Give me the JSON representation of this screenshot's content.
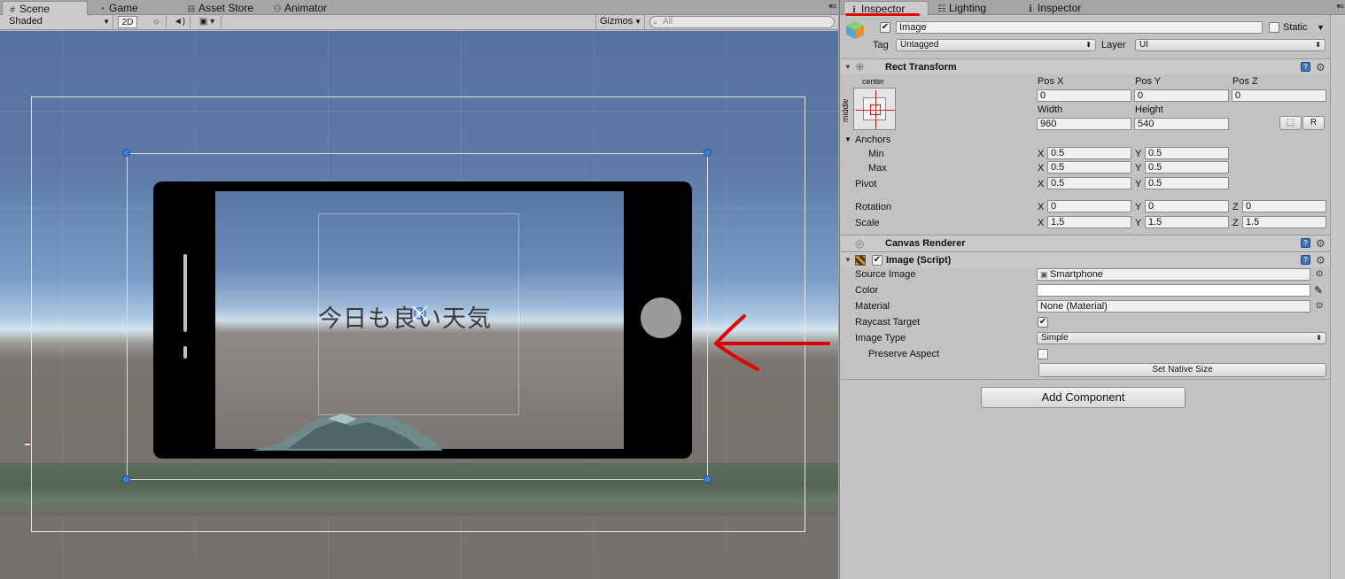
{
  "scene_panel": {
    "tabs": [
      {
        "icon": "grid-icon",
        "label": "Scene"
      },
      {
        "icon": "pacman-icon",
        "label": "Game"
      },
      {
        "icon": "store-icon",
        "label": "Asset Store"
      },
      {
        "icon": "animator-icon",
        "label": "Animator"
      }
    ],
    "toolbar": {
      "shading_mode": "Shaded",
      "mode_2d": "2D",
      "gizmos_label": "Gizmos",
      "search_placeholder": "All"
    },
    "scene_text": "今日も良い天気"
  },
  "inspector_panel": {
    "tabs": [
      {
        "icon": "info-icon",
        "label": "Inspector"
      },
      {
        "icon": "lighting-icon",
        "label": "Lighting"
      },
      {
        "icon": "info-icon",
        "label": "Inspector"
      }
    ],
    "header": {
      "object_name": "Image",
      "static_label": "Static",
      "tag_label": "Tag",
      "tag_value": "Untagged",
      "layer_label": "Layer",
      "layer_value": "UI"
    },
    "rect_transform": {
      "title": "Rect Transform",
      "anchor_h": "center",
      "anchor_v": "middle",
      "pos_x_label": "Pos X",
      "pos_x": "0",
      "pos_y_label": "Pos Y",
      "pos_y": "0",
      "pos_z_label": "Pos Z",
      "pos_z": "0",
      "width_label": "Width",
      "width": "960",
      "height_label": "Height",
      "height": "540",
      "r_button": "R",
      "anchors_label": "Anchors",
      "min_label": "Min",
      "min_x": "0.5",
      "min_y": "0.5",
      "max_label": "Max",
      "max_x": "0.5",
      "max_y": "0.5",
      "pivot_label": "Pivot",
      "pivot_x": "0.5",
      "pivot_y": "0.5",
      "rotation_label": "Rotation",
      "rot_x": "0",
      "rot_y": "0",
      "rot_z": "0",
      "scale_label": "Scale",
      "scale_x": "1.5",
      "scale_y": "1.5",
      "scale_z": "1.5",
      "x": "X",
      "y": "Y",
      "z": "Z"
    },
    "canvas_renderer": {
      "title": "Canvas Renderer"
    },
    "image_script": {
      "title": "Image (Script)",
      "source_image_label": "Source Image",
      "source_image": "Smartphone",
      "color_label": "Color",
      "material_label": "Material",
      "material": "None (Material)",
      "raycast_label": "Raycast Target",
      "image_type_label": "Image Type",
      "image_type": "Simple",
      "preserve_label": "Preserve Aspect",
      "native_size_button": "Set Native Size"
    },
    "add_component_button": "Add Component"
  },
  "colors": {
    "annotation_red": "#e00000",
    "handle_blue": "#3f7fdc"
  }
}
